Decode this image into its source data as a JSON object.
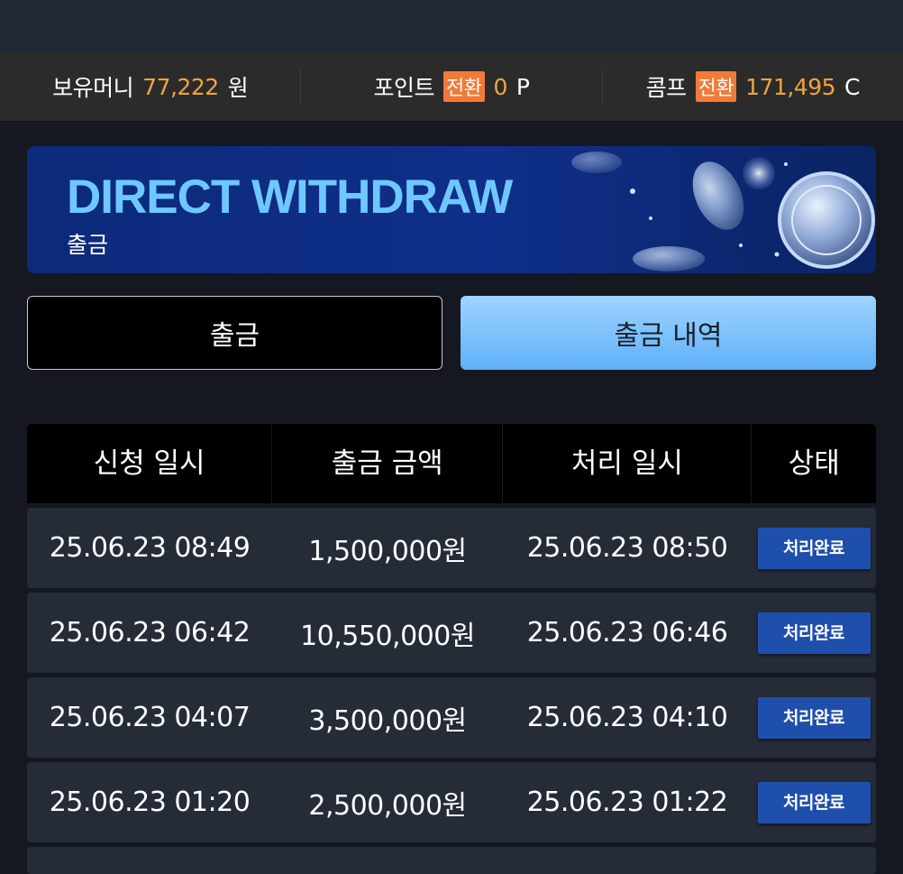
{
  "wallet": {
    "money": {
      "label": "보유머니",
      "value": "77,222",
      "unit": "원"
    },
    "point": {
      "label": "포인트",
      "convert": "전환",
      "value": "0",
      "unit": "P"
    },
    "comp": {
      "label": "콤프",
      "convert": "전환",
      "value": "171,495",
      "unit": "C"
    }
  },
  "banner": {
    "title": "DIRECT WITHDRAW",
    "subtitle": "출금"
  },
  "tabs": [
    {
      "label": "출금",
      "active": false
    },
    {
      "label": "출금 내역",
      "active": true
    }
  ],
  "table": {
    "headers": [
      "신청 일시",
      "출금 금액",
      "처리 일시",
      "상태"
    ],
    "rows": [
      {
        "requested": "25.06.23 08:49",
        "amount": "1,500,000원",
        "processed": "25.06.23 08:50",
        "status": "처리완료"
      },
      {
        "requested": "25.06.23 06:42",
        "amount": "10,550,000원",
        "processed": "25.06.23 06:46",
        "status": "처리완료"
      },
      {
        "requested": "25.06.23 04:07",
        "amount": "3,500,000원",
        "processed": "25.06.23 04:10",
        "status": "처리완료"
      },
      {
        "requested": "25.06.23 01:20",
        "amount": "2,500,000원",
        "processed": "25.06.23 01:22",
        "status": "처리완료"
      }
    ]
  },
  "colors": {
    "accent": "#f0a53a",
    "badge": "#f07a38",
    "status_badge": "#1f4fad",
    "active_tab": "#7cc1fb"
  }
}
